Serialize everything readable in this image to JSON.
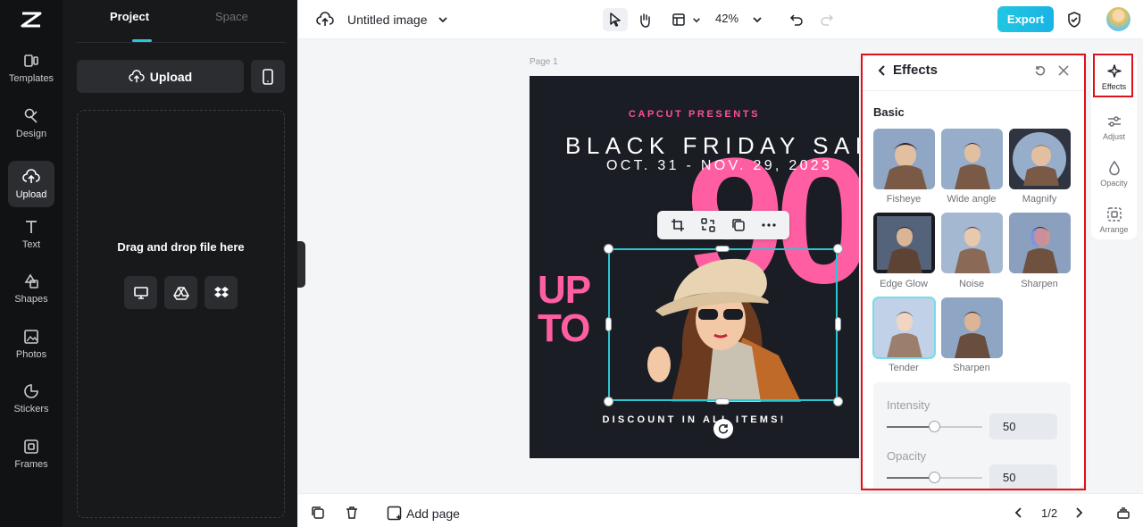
{
  "rail": {
    "items": [
      {
        "label": "Templates",
        "icon": "templates-icon"
      },
      {
        "label": "Design",
        "icon": "design-icon"
      },
      {
        "label": "Upload",
        "icon": "upload-cloud-icon"
      },
      {
        "label": "Text",
        "icon": "text-icon"
      },
      {
        "label": "Shapes",
        "icon": "shapes-icon"
      },
      {
        "label": "Photos",
        "icon": "photos-icon"
      },
      {
        "label": "Stickers",
        "icon": "stickers-icon"
      },
      {
        "label": "Frames",
        "icon": "frames-icon"
      }
    ],
    "active": "Upload"
  },
  "panel": {
    "tabs": [
      "Project",
      "Space"
    ],
    "upload_label": "Upload",
    "drop_text": "Drag and drop file here"
  },
  "topbar": {
    "doc_title": "Untitled image",
    "zoom": "42%",
    "export_label": "Export"
  },
  "canvas": {
    "page_label": "Page 1",
    "capcut": "CAPCUT PRESENTS",
    "headline": "BLACK FRIDAY SAL",
    "dates": "OCT. 31 - NOV. 29, 2023",
    "big_number": "90",
    "upto_1": "UP",
    "upto_2": "TO",
    "discount": "DISCOUNT IN ALL ITEMS!"
  },
  "effects": {
    "title": "Effects",
    "section": "Basic",
    "items": [
      "Fisheye",
      "Wide angle",
      "Magnify",
      "Edge Glow",
      "Noise",
      "Sharpen",
      "Tender",
      "Sharpen"
    ],
    "selected": "Tender",
    "intensity_label": "Intensity",
    "intensity_value": "50",
    "intensity": 50,
    "opacity_label": "Opacity",
    "opacity_value": "50",
    "opacity": 50
  },
  "right_rail": {
    "items": [
      "Effects",
      "Adjust",
      "Opacity",
      "Arrange"
    ],
    "active": "Effects"
  },
  "bottombar": {
    "add_page": "Add page",
    "pager": "1/2"
  },
  "colors": {
    "accent": "#2ec5d3",
    "pink": "#ff5fa2",
    "highlight": "#e0101a"
  }
}
